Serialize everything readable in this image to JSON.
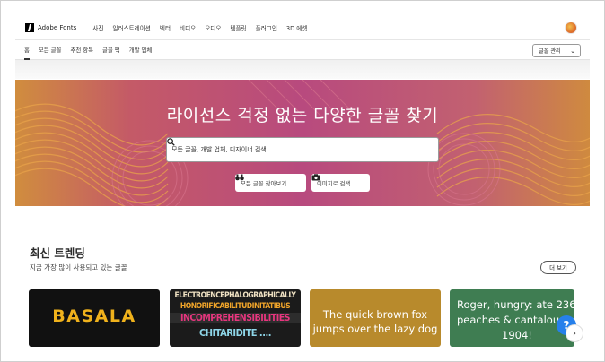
{
  "app": {
    "brand": "Adobe Fonts"
  },
  "nav": {
    "items": [
      "사진",
      "일러스트레이션",
      "벡터",
      "비디오",
      "오디오",
      "템플릿",
      "플러그인",
      "3D 에셋"
    ]
  },
  "subnav": {
    "items": [
      "홈",
      "모든 글꼴",
      "추천 항목",
      "글꼴 팩",
      "개발 업체"
    ],
    "manage_label": "글꼴 관리"
  },
  "hero": {
    "title": "라이선스 걱정 없는 다양한 글꼴 찾기",
    "search_placeholder": "모든 글꼴, 개발 업체, 디자이너 검색",
    "browse_label": "모든 글꼴 찾아보기",
    "image_search_label": "이미지로 검색"
  },
  "trending": {
    "title": "최신 트렌딩",
    "subtitle": "지금 가장 많이 사용되고 있는 글꼴",
    "more_label": "더 보기",
    "cards": [
      {
        "text": "BASALA"
      },
      {
        "lines": [
          "ELECTROENCEPHALOGRAPHICALLY",
          "HONORIFICABILITUDINITATIBUS",
          "INCOMPREHENSIBILITIES",
          "CHITARIDITE ...."
        ]
      },
      {
        "line1": "The quick brown fox",
        "line2": "jumps over the lazy dog"
      },
      {
        "line1": "Roger, hungry: ate 236",
        "line2": "peaches & cantaloupes in",
        "line3": "1904!"
      }
    ]
  },
  "help": {
    "label": "?"
  },
  "colors": {
    "accent": "#2680eb",
    "hero_pink": "#b84a7e",
    "hero_orange": "#d08d3e"
  }
}
